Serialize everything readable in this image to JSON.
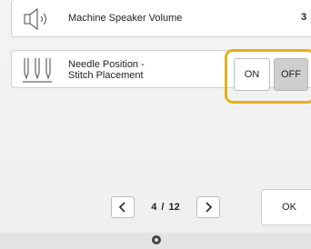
{
  "settings": [
    {
      "icon": "speaker-icon",
      "label": "Machine Speaker Volume",
      "value": "3"
    },
    {
      "icon": "needle-position-icon",
      "label": "Needle Position -\nStitch Placement",
      "options": [
        "ON",
        "OFF"
      ],
      "selected": "OFF"
    }
  ],
  "pager": {
    "current": "4",
    "separator": "/",
    "total": "12"
  },
  "ok_label": "OK",
  "colors": {
    "highlight": "#e2b21d",
    "selected_button": "#cfcfcf",
    "background": "#f2f2f2"
  }
}
